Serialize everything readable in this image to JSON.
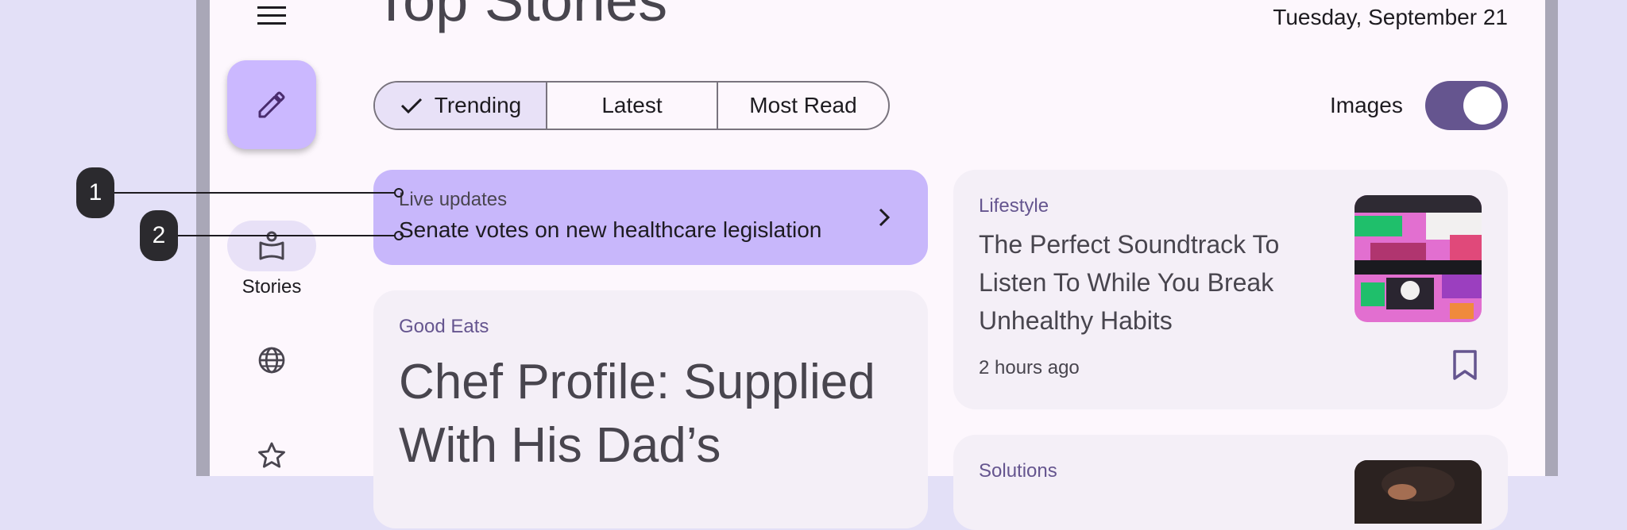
{
  "header": {
    "title": "Top Stories",
    "date": "Tuesday, September 21"
  },
  "rail": {
    "stories_label": "Stories"
  },
  "filters": {
    "segments": [
      "Trending",
      "Latest",
      "Most Read"
    ],
    "selected": "Trending",
    "images_label": "Images",
    "images_on": true
  },
  "live": {
    "kicker": "Live updates",
    "title": "Senate votes on new healthcare legislation"
  },
  "featured": {
    "kicker": "Good Eats",
    "title": "Chef Profile: Supplied With His Dad’s"
  },
  "side_story": {
    "kicker": "Lifestyle",
    "title": "The Perfect Soundtrack To Listen To While You Break Unhealthy Habits",
    "time": "2 hours ago"
  },
  "side_story2": {
    "kicker": "Solutions"
  },
  "callouts": [
    "1",
    "2"
  ],
  "colors": {
    "primary": "#65558f",
    "primary_container": "#cbb8ff",
    "surface": "#fdf7fd",
    "card": "#f4eff7",
    "live_card": "#c8b7fb"
  }
}
